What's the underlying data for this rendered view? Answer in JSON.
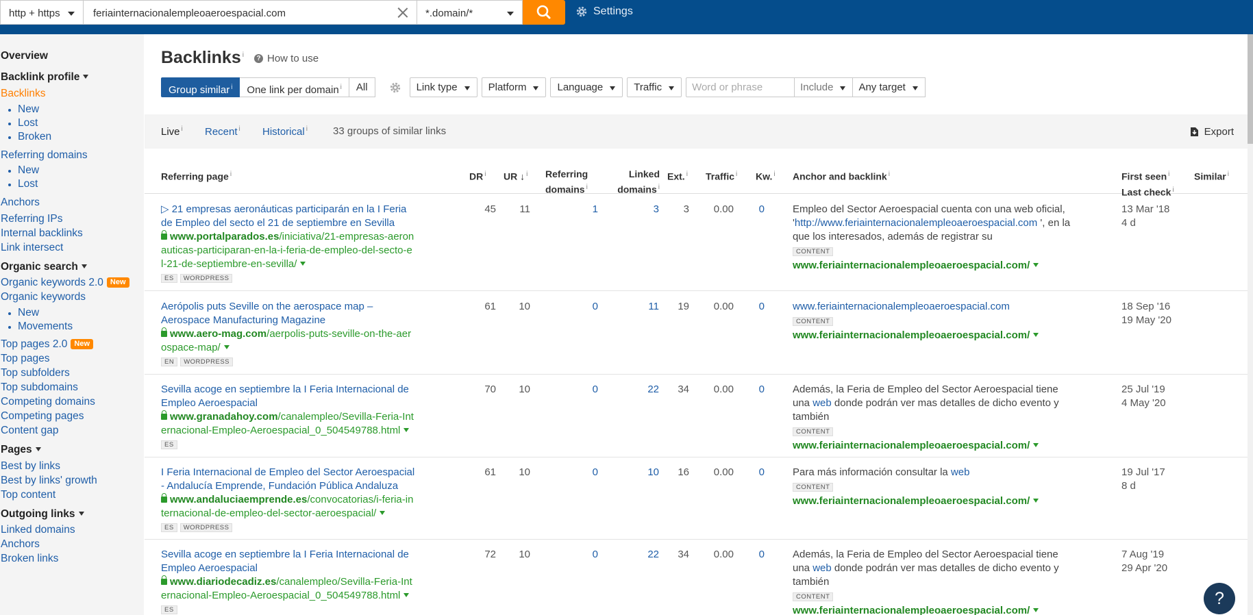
{
  "topbar": {
    "protocol": "http + https",
    "url_value": "feriainternacionalempleoaeroespacial.com",
    "mode": "*.domain/*",
    "settings_label": "Settings"
  },
  "sidebar": {
    "overview": "Overview",
    "backlink_profile": "Backlink profile",
    "backlinks": "Backlinks",
    "backlinks_new": "New",
    "backlinks_lost": "Lost",
    "backlinks_broken": "Broken",
    "referring_domains": "Referring domains",
    "rd_new": "New",
    "rd_lost": "Lost",
    "anchors": "Anchors",
    "referring_ips": "Referring IPs",
    "internal_backlinks": "Internal backlinks",
    "link_intersect": "Link intersect",
    "organic_search": "Organic search",
    "organic_keywords_2": "Organic keywords 2.0",
    "new_badge": "New",
    "organic_keywords": "Organic keywords",
    "ok_new": "New",
    "ok_movements": "Movements",
    "top_pages_2": "Top pages 2.0",
    "top_pages": "Top pages",
    "top_subfolders": "Top subfolders",
    "top_subdomains": "Top subdomains",
    "competing_domains": "Competing domains",
    "competing_pages": "Competing pages",
    "content_gap": "Content gap",
    "pages": "Pages",
    "best_by_links": "Best by links",
    "best_by_links_growth": "Best by links' growth",
    "top_content": "Top content",
    "outgoing_links": "Outgoing links",
    "linked_domains": "Linked domains",
    "anchors_out": "Anchors",
    "broken_links": "Broken links"
  },
  "header": {
    "title": "Backlinks",
    "info": "i",
    "how_to_use": "How to use"
  },
  "filters": {
    "group_similar": "Group similar",
    "one_link": "One link per domain",
    "all": "All",
    "link_type": "Link type",
    "platform": "Platform",
    "language": "Language",
    "traffic": "Traffic",
    "phrase_placeholder": "Word or phrase",
    "include": "Include",
    "any_target": "Any target"
  },
  "tabs": {
    "live": "Live",
    "recent": "Recent",
    "historical": "Historical",
    "groups_count": "33 groups of similar links",
    "export": "Export"
  },
  "columns": {
    "referring_page": "Referring page",
    "dr": "DR",
    "ur": "UR",
    "referring_domains_1": "Referring",
    "referring_domains_2": "domains",
    "linked_domains_1": "Linked",
    "linked_domains_2": "domains",
    "ext": "Ext.",
    "traffic": "Traffic",
    "kw": "Kw.",
    "anchor": "Anchor and backlink",
    "first_seen": "First seen",
    "last_check": "Last check",
    "similar": "Similar"
  },
  "rows": [
    {
      "title": "▷ 21 empresas aeronáuticas participarán en la I Feria de Empleo del secto el 21 de septiembre en Sevilla",
      "domain": "www.portalparados.es",
      "path": "/iniciativa/21-empresas-aeronauticas-participaran-en-la-i-feria-de-empleo-del-secto-el-21-de-septiembre-en-sevilla/",
      "tag1": "ES",
      "tag2": "WORDPRESS",
      "dr": "45",
      "ur": "11",
      "ref_domains": "1",
      "linked_domains": "3",
      "ext": "3",
      "traffic": "0.00",
      "kw": "0",
      "anchor_pre": "Empleo del Sector Aeroespacial cuenta con una web oficial, '",
      "anchor_link": "http://www.feriainternacionalempleoaeroespacial.com",
      "anchor_post": " ', en la que los interesados, además de registrar su",
      "content": "CONTENT",
      "target": "www.feriainternacionalempleoaeroespacial.com/",
      "first_seen": "13 Mar '18",
      "last_check": "4 d"
    },
    {
      "title": "Aerópolis puts Seville on the aerospace map – Aerospace Manufacturing Magazine",
      "domain": "www.aero-mag.com",
      "path": "/aerpolis-puts-seville-on-the-aerospace-map/",
      "tag1": "EN",
      "tag2": "WORDPRESS",
      "dr": "61",
      "ur": "10",
      "ref_domains": "0",
      "linked_domains": "11",
      "ext": "19",
      "traffic": "0.00",
      "kw": "0",
      "anchor_pre": "",
      "anchor_link": "www.feriainternacionalempleoaeroespacial.com",
      "anchor_post": "",
      "content": "CONTENT",
      "target": "www.feriainternacionalempleoaeroespacial.com/",
      "first_seen": "18 Sep '16",
      "last_check": "19 May '20"
    },
    {
      "title": "Sevilla acoge en septiembre la I Feria Internacional de Empleo Aeroespacial",
      "domain": "www.granadahoy.com",
      "path": "/canalempleo/Sevilla-Feria-Internacional-Empleo-Aeroespacial_0_504549788.html",
      "tag1": "ES",
      "tag2": "",
      "dr": "70",
      "ur": "10",
      "ref_domains": "0",
      "linked_domains": "22",
      "ext": "34",
      "traffic": "0.00",
      "kw": "0",
      "anchor_pre": "Además, la Feria de Empleo del Sector Aeroespacial tiene una ",
      "anchor_link": "web",
      "anchor_post": " donde podrán ver mas detalles de dicho evento y también",
      "content": "CONTENT",
      "target": "www.feriainternacionalempleoaeroespacial.com/",
      "first_seen": "25 Jul '19",
      "last_check": "4 May '20"
    },
    {
      "title": "I Feria Internacional de Empleo del Sector Aeroespacial - Andalucía Emprende, Fundación Pública Andaluza",
      "domain": "www.andaluciaemprende.es",
      "path": "/convocatorias/i-feria-internacional-de-empleo-del-sector-aeroespacial/",
      "tag1": "ES",
      "tag2": "WORDPRESS",
      "dr": "61",
      "ur": "10",
      "ref_domains": "0",
      "linked_domains": "10",
      "ext": "16",
      "traffic": "0.00",
      "kw": "0",
      "anchor_pre": "Para más información consultar la ",
      "anchor_link": "web",
      "anchor_post": "",
      "content": "CONTENT",
      "target": "www.feriainternacionalempleoaeroespacial.com/",
      "first_seen": "19 Jul '17",
      "last_check": "8 d"
    },
    {
      "title": "Sevilla acoge en septiembre la I Feria Internacional de Empleo Aeroespacial",
      "domain": "www.diariodecadiz.es",
      "path": "/canalempleo/Sevilla-Feria-Internacional-Empleo-Aeroespacial_0_504549788.html",
      "tag1": "ES",
      "tag2": "",
      "dr": "72",
      "ur": "10",
      "ref_domains": "0",
      "linked_domains": "22",
      "ext": "34",
      "traffic": "0.00",
      "kw": "0",
      "anchor_pre": "Además, la Feria de Empleo del Sector Aeroespacial tiene una ",
      "anchor_link": "web",
      "anchor_post": " donde podrán ver mas detalles de dicho evento y también",
      "content": "CONTENT",
      "target": "www.feriainternacionalempleoaeroespacial.com/",
      "first_seen": "7 Aug '19",
      "last_check": "29 Apr '20"
    }
  ],
  "help_label": "?"
}
